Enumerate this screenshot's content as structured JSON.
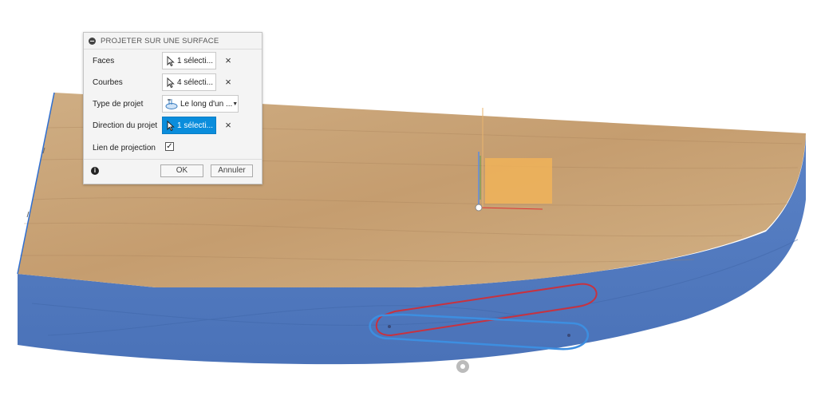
{
  "dialog": {
    "title": "PROJETER SUR UNE SURFACE",
    "rows": [
      {
        "label": "Faces",
        "value": "1 sélecti...",
        "clear_icon": "×"
      },
      {
        "label": "Courbes",
        "value": "4 sélecti...",
        "clear_icon": "×"
      },
      {
        "label": "Type de projet",
        "value": "Le long d'un ...",
        "caret": "▼"
      },
      {
        "label": "Direction du projet",
        "value": "1 sélecti...",
        "clear_icon": "×"
      },
      {
        "label": "Lien de projection",
        "checked": true,
        "check_mark": "✓"
      }
    ],
    "info_icon": "i",
    "ok_label": "OK",
    "cancel_label": "Annuler"
  },
  "colors": {
    "wood": "#c9a274",
    "blue_face": "#4f79c0",
    "active_button": "#0a8ddc",
    "red_curve": "#c8323f",
    "blue_curve": "#3d8ee0"
  },
  "icons": [
    "collapse-icon",
    "cursor-select-icon",
    "close-icon",
    "project-type-icon",
    "checkbox",
    "info-icon",
    "orbit-icon"
  ]
}
